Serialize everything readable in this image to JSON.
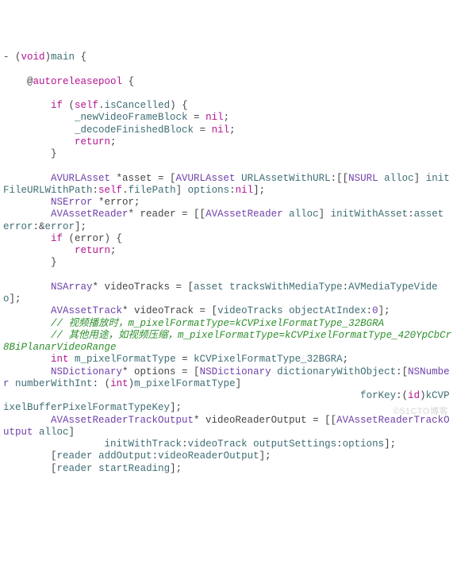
{
  "code": {
    "l1a": "- (",
    "l1b": "void",
    "l1c": ")",
    "l1d": "main",
    "l1e": " {",
    "l2": "",
    "l3a": "    @",
    "l3b": "autoreleasepool",
    "l3c": " {",
    "l4": "",
    "l5a": "        ",
    "l5b": "if",
    "l5c": " (",
    "l5d": "self",
    "l5e": ".",
    "l5f": "isCancelled",
    "l5g": ") {",
    "l6a": "            ",
    "l6b": "_newVideoFrameBlock",
    "l6c": " = ",
    "l6d": "nil",
    "l6e": ";",
    "l7a": "            ",
    "l7b": "_decodeFinishedBlock",
    "l7c": " = ",
    "l7d": "nil",
    "l7e": ";",
    "l8a": "            ",
    "l8b": "return",
    "l8c": ";",
    "l9": "        }",
    "l10": "",
    "l11a": "        ",
    "l11b": "AVURLAsset",
    "l11c": " *asset = [",
    "l11d": "AVURLAsset",
    "l11e": " ",
    "l11f": "URLAssetWithURL",
    "l11g": ":[[",
    "l11h": "NSURL",
    "l11i": " ",
    "l11j": "alloc",
    "l11k": "] ",
    "l11l": "initFileURLWithPath",
    "l11m": ":",
    "l11n": "self",
    "l11o": ".",
    "l11p": "filePath",
    "l11q": "] ",
    "l11r": "options",
    "l11s": ":",
    "l11t": "nil",
    "l11u": "];",
    "l12a": "        ",
    "l12b": "NSError",
    "l12c": " *error;",
    "l13a": "        ",
    "l13b": "AVAssetReader",
    "l13c": "* reader = [[",
    "l13d": "AVAssetReader",
    "l13e": " ",
    "l13f": "alloc",
    "l13g": "] ",
    "l13h": "initWithAsset",
    "l13i": ":",
    "l13j": "asset",
    "l13k": " ",
    "l13l": "error",
    "l13m": ":&",
    "l13n": "error",
    "l13o": "];",
    "l14a": "        ",
    "l14b": "if",
    "l14c": " (error) {",
    "l15a": "            ",
    "l15b": "return",
    "l15c": ";",
    "l16": "        }",
    "l17": "",
    "l18a": "        ",
    "l18b": "NSArray",
    "l18c": "* videoTracks = [",
    "l18d": "asset",
    "l18e": " ",
    "l18f": "tracksWithMediaType",
    "l18g": ":",
    "l18h": "AVMediaTypeVideo",
    "l18i": "];",
    "l19a": "        ",
    "l19b": "AVAssetTrack",
    "l19c": "* videoTrack = [",
    "l19d": "videoTracks",
    "l19e": " ",
    "l19f": "objectAtIndex",
    "l19g": ":",
    "l19h": "0",
    "l19i": "];",
    "l20a": "        ",
    "l20b": "// 视频播放时，m_pixelFormatType=kCVPixelFormatType_32BGRA",
    "l21a": "        ",
    "l21b": "// 其他用途，如视频压缩，m_pixelFormatType=kCVPixelFormatType_420YpCbCr8BiPlanarVideoRange",
    "l22a": "        ",
    "l22b": "int",
    "l22c": " ",
    "l22d": "m_pixelFormatType",
    "l22e": " = ",
    "l22f": "kCVPixelFormatType_32BGRA",
    "l22g": ";",
    "l23a": "        ",
    "l23b": "NSDictionary",
    "l23c": "* options = [",
    "l23d": "NSDictionary",
    "l23e": " ",
    "l23f": "dictionaryWithObject",
    "l23g": ":[",
    "l23h": "NSNumber",
    "l23i": " ",
    "l23j": "numberWithInt",
    "l23k": ": (",
    "l23l": "int",
    "l23m": ")",
    "l23n": "m_pixelFormatType",
    "l23o": "]",
    "l24a": "                                                            ",
    "l24b": "forKey",
    "l24c": ":(",
    "l24d": "id",
    "l24e": ")",
    "l24f": "kCVPixelBufferPixelFormatTypeKey",
    "l24g": "];",
    "l25a": "        ",
    "l25b": "AVAssetReaderTrackOutput",
    "l25c": "* videoReaderOutput = [[",
    "l25d": "AVAssetReaderTrackOutput",
    "l25e": " ",
    "l25f": "alloc",
    "l25g": "]",
    "l26a": "                 ",
    "l26b": "initWithTrack",
    "l26c": ":",
    "l26d": "videoTrack",
    "l26e": " ",
    "l26f": "outputSettings",
    "l26g": ":",
    "l26h": "options",
    "l26i": "];",
    "l27a": "        [",
    "l27b": "reader",
    "l27c": " ",
    "l27d": "addOutput",
    "l27e": ":",
    "l27f": "videoReaderOutput",
    "l27g": "];",
    "l28a": "        [",
    "l28b": "reader",
    "l28c": " ",
    "l28d": "startReading",
    "l28e": "];"
  },
  "watermark": "©51CTO博客"
}
